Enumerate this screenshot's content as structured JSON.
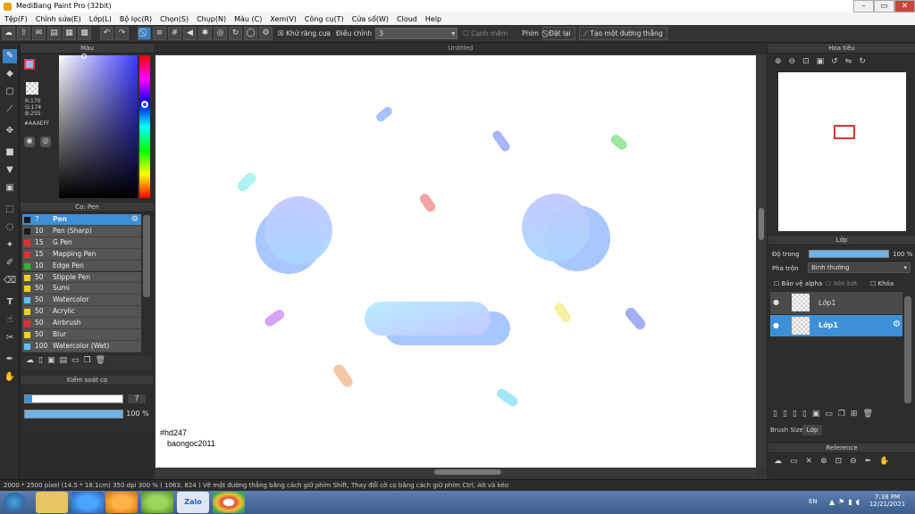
{
  "window": {
    "title": "MediBang Paint Pro (32bit)"
  },
  "menu": [
    "Tệp(F)",
    "Chỉnh sửa(E)",
    "Lớp(L)",
    "Bộ lọc(R)",
    "Chọn(S)",
    "Chụp(N)",
    "Màu (C)",
    "Xem(V)",
    "Công cụ(T)",
    "Cửa sổ(W)",
    "Cloud",
    "Help"
  ],
  "toolbar": {
    "antialias_label": "Khử răng cưa",
    "adjust_label": "Điều chỉnh",
    "adjust_value": "3",
    "edge_label": "Cạnh mềm",
    "key_label": "Phím",
    "reset_label": "Đặt lại",
    "line_label": "Tạo một đường thẳng"
  },
  "color_panel": {
    "title": "Màu",
    "r": "R:170",
    "g": "G:174",
    "b": "B:255",
    "hex": "#AAAEFF"
  },
  "brush_panel": {
    "title": "Cọ: Pen",
    "brushes": [
      {
        "size": "7",
        "name": "Pen",
        "color": "#1a1a1a"
      },
      {
        "size": "10",
        "name": "Pen (Sharp)",
        "color": "#1a1a1a"
      },
      {
        "size": "15",
        "name": "G Pen",
        "color": "#e03030"
      },
      {
        "size": "15",
        "name": "Mapping Pen",
        "color": "#e03030"
      },
      {
        "size": "10",
        "name": "Edge Pen",
        "color": "#2db52d"
      },
      {
        "size": "50",
        "name": "Stipple Pen",
        "color": "#f0d020"
      },
      {
        "size": "50",
        "name": "Sumi",
        "color": "#f0d020"
      },
      {
        "size": "50",
        "name": "Watercolor",
        "color": "#60c0f0"
      },
      {
        "size": "50",
        "name": "Acrylic",
        "color": "#f0d020"
      },
      {
        "size": "50",
        "name": "Airbrush",
        "color": "#e03030"
      },
      {
        "size": "50",
        "name": "Blur",
        "color": "#f0d020"
      },
      {
        "size": "100",
        "name": "Watercolor (Wet)",
        "color": "#60c0f0"
      }
    ]
  },
  "brush_control": {
    "title": "Kiểm soát cọ",
    "size_value": "7",
    "opacity_value": "100 %",
    "size_fraction": 0.07,
    "opacity_fraction": 1.0
  },
  "canvas": {
    "doc_title": "Untitled",
    "signature_line1": "#hd247",
    "signature_line2": "baongoc2011"
  },
  "navigator": {
    "title": "Hoa tiêu"
  },
  "layer_panel": {
    "title": "Lớp",
    "opacity_label": "Độ trong",
    "opacity_value": "100 %",
    "blend_label": "Pha trộn",
    "blend_value": "Bình thường",
    "protect_alpha": "Bảo vệ alpha",
    "clip": "Xén bớt",
    "lock": "Khóa",
    "layers": [
      {
        "name": "Lớp1",
        "selected": false
      },
      {
        "name": "Lớp1",
        "selected": true
      }
    ],
    "tab_brush_size": "Brush Size",
    "tab_layer": "Lớp"
  },
  "reference": {
    "title": "Reference"
  },
  "status": {
    "text": "2000 * 2500 pixel   (14.5 * 18.1cm)   350 dpi   300 %   ( 1063, 824 )   Vẽ một đường thẳng bằng cách giữ phím Shift, Thay đổi cỡ cọ bằng cách giữ phím Ctrl, Alt và kéo"
  },
  "taskbar": {
    "lang": "EN",
    "time": "7:38 PM",
    "date": "12/21/2021",
    "zalo": "Zalo"
  },
  "colors": {
    "accent": "#3d8fd6",
    "panel": "#2d2d2d",
    "foreground_color": "#AAAEFF"
  }
}
